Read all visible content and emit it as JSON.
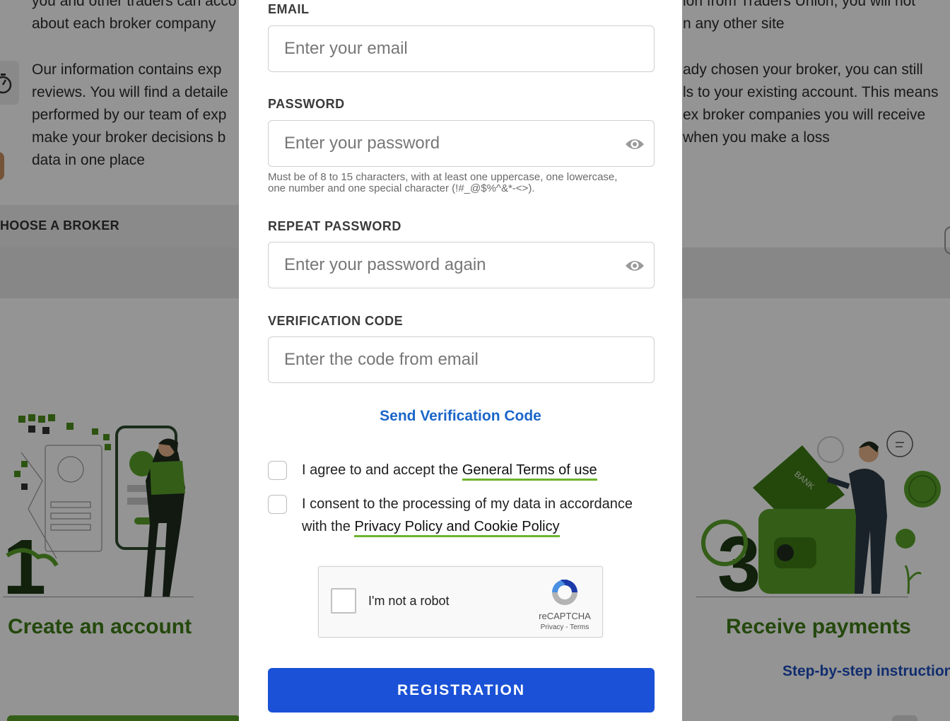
{
  "background": {
    "left_text_top": [
      "you and other traders can acco",
      "about each broker company"
    ],
    "left_text_main": [
      "Our information contains exp",
      "reviews. You will find a detaile",
      "performed by our team of exp",
      "make your broker decisions b",
      "data in one place"
    ],
    "right_text_top": [
      "ion from Traders Union, you will not",
      "n any other site"
    ],
    "right_text_main": [
      "ady chosen your broker, you can still",
      "ls to your existing account. This means",
      "ex broker companies you will receive",
      "when you make a loss"
    ],
    "broker_bar_label": "HOOSE A BROKER",
    "step1_number": "1",
    "step1_title": "Create an account",
    "step3_number": "3",
    "step3_title": "Receive payments",
    "step3_link": "Step-by-step instruction",
    "wallet_label": "BANK"
  },
  "form": {
    "email": {
      "label": "EMAIL",
      "placeholder": "Enter your email",
      "value": ""
    },
    "password": {
      "label": "PASSWORD",
      "placeholder": "Enter your password",
      "value": "",
      "hint": "Must be of 8 to 15 characters, with at least one uppercase, one lowercase, one number and one special character (!#_@$%^&*-<>)."
    },
    "repeat_password": {
      "label": "REPEAT PASSWORD",
      "placeholder": "Enter your password again",
      "value": ""
    },
    "verification_code": {
      "label": "VERIFICATION CODE",
      "placeholder": "Enter the code from email",
      "value": ""
    },
    "send_code_label": "Send Verification Code",
    "terms": {
      "prefix": "I agree to and accept the ",
      "link": "General Terms of use",
      "checked": false
    },
    "consent": {
      "prefix": "I consent to the processing of my data in accordance with the ",
      "link": "Privacy Policy and Cookie Policy",
      "checked": false
    },
    "recaptcha": {
      "label": "I'm not a robot",
      "brand": "reCAPTCHA",
      "privacy": "Privacy",
      "separator": " - ",
      "terms": "Terms"
    },
    "submit_label": "REGISTRATION"
  },
  "colors": {
    "accent_green": "#6bb52c",
    "title_green": "#3f7d16",
    "link_blue": "#1b66c9",
    "button_blue": "#1a51d6"
  }
}
